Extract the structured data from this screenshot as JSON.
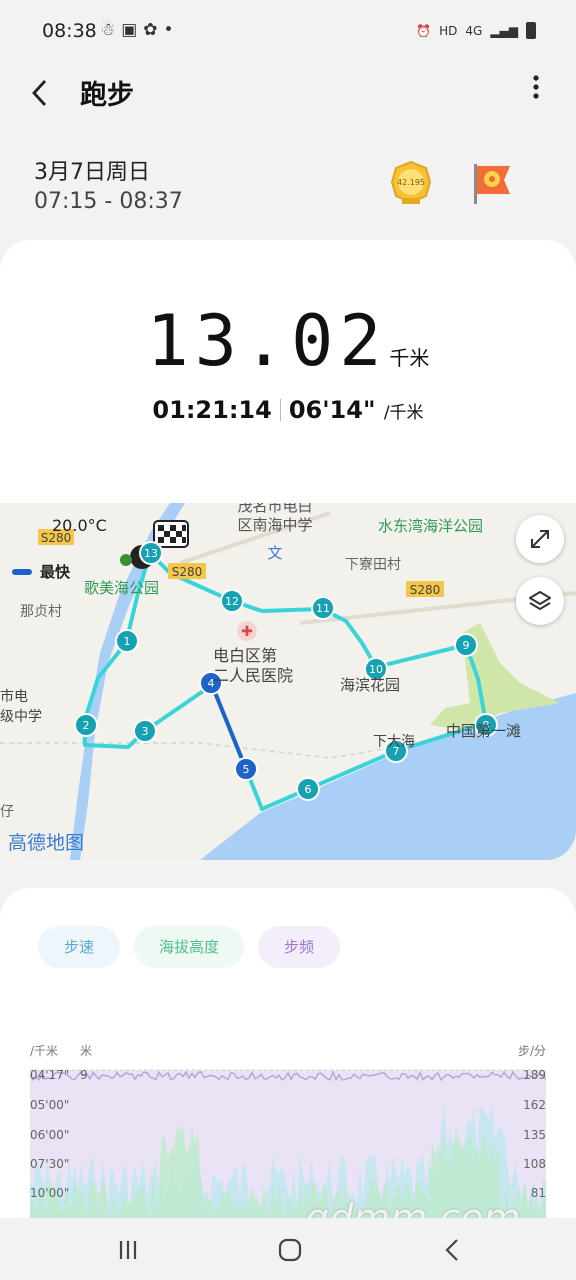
{
  "status": {
    "time": "08:38",
    "network": "HD",
    "network_type": "4G"
  },
  "header": {
    "title": "跑步"
  },
  "session": {
    "date": "3月7日周日",
    "time_range": "07:15 - 08:37",
    "medal_text": "42.195"
  },
  "summary": {
    "distance": "13.02",
    "distance_unit": "千米",
    "duration": "01:21:14",
    "pace": "06'14\"",
    "pace_unit": "/千米"
  },
  "map": {
    "temperature": "20.0°C",
    "fastest_label": "最快",
    "labels": {
      "school": "茂名市电白区南海中学",
      "school_l1": "茂名市电白",
      "school_l2": "区南海中学",
      "park_right": "水东湾海洋公园",
      "village_right": "下寮田村",
      "park_left": "歌美海公园",
      "village_left": "那贞村",
      "hospital_l1": "电白区第",
      "hospital_l2": "二人民医院",
      "garden": "海滨花园",
      "sea": "下大海",
      "beach": "中国第一滩",
      "school_left_l1": "市电",
      "school_left_l2": "级中学",
      "road1": "S280",
      "road2": "S280",
      "road3": "S280",
      "small": "仔",
      "brand": "高德地图"
    },
    "km_markers": [
      "1",
      "2",
      "3",
      "4",
      "5",
      "6",
      "7",
      "8",
      "9",
      "10",
      "11",
      "12",
      "13"
    ]
  },
  "chart": {
    "tabs": [
      "步速",
      "海拔高度",
      "步频"
    ],
    "left_unit": "/千米",
    "mid_unit": "米",
    "right_unit": "步/分",
    "pace_ticks": [
      "04'17\"",
      "05'00\"",
      "06'00\"",
      "07'30\"",
      "10'00\""
    ],
    "alt_ticks": [
      "9"
    ],
    "cadence_ticks": [
      "189",
      "162",
      "135",
      "108",
      "81"
    ]
  },
  "watermark": "gdmm.com",
  "colors": {
    "route": "#3ad3d8",
    "marker": "#17a2b4",
    "fast": "#1e63c7",
    "sea": "#a9cff6",
    "land": "#f3f1ec"
  }
}
